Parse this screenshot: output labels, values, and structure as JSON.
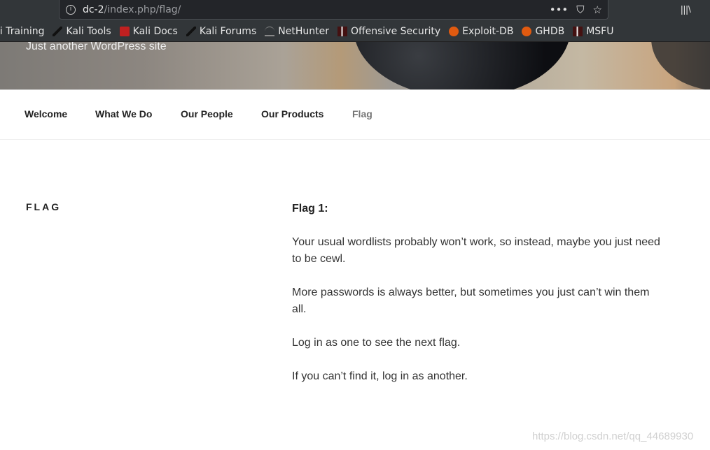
{
  "browser": {
    "url_host": "dc-2",
    "url_path": "/index.php/flag/",
    "bookmarks": [
      {
        "label": "li Training",
        "icon": "none"
      },
      {
        "label": "Kali Tools",
        "icon": "dragon"
      },
      {
        "label": "Kali Docs",
        "icon": "doc"
      },
      {
        "label": "Kali Forums",
        "icon": "dragon"
      },
      {
        "label": "NetHunter",
        "icon": "nh"
      },
      {
        "label": "Offensive Security",
        "icon": "os"
      },
      {
        "label": "Exploit-DB",
        "icon": "bug"
      },
      {
        "label": "GHDB",
        "icon": "bug"
      },
      {
        "label": "MSFU",
        "icon": "os"
      }
    ]
  },
  "site": {
    "tagline": "Just another WordPress site"
  },
  "nav": [
    {
      "label": "Welcome"
    },
    {
      "label": "What We Do"
    },
    {
      "label": "Our People"
    },
    {
      "label": "Our Products"
    },
    {
      "label": "Flag",
      "current": true
    }
  ],
  "page": {
    "title": "FLAG",
    "heading": "Flag 1:",
    "paragraphs": [
      "Your usual wordlists probably won’t work, so instead, maybe you just need to be cewl.",
      "More passwords is always better, but sometimes you just can’t win them all.",
      "Log in as one to see the next flag.",
      "If you can’t find it, log in as another."
    ]
  },
  "watermark": "https://blog.csdn.net/qq_44689930"
}
